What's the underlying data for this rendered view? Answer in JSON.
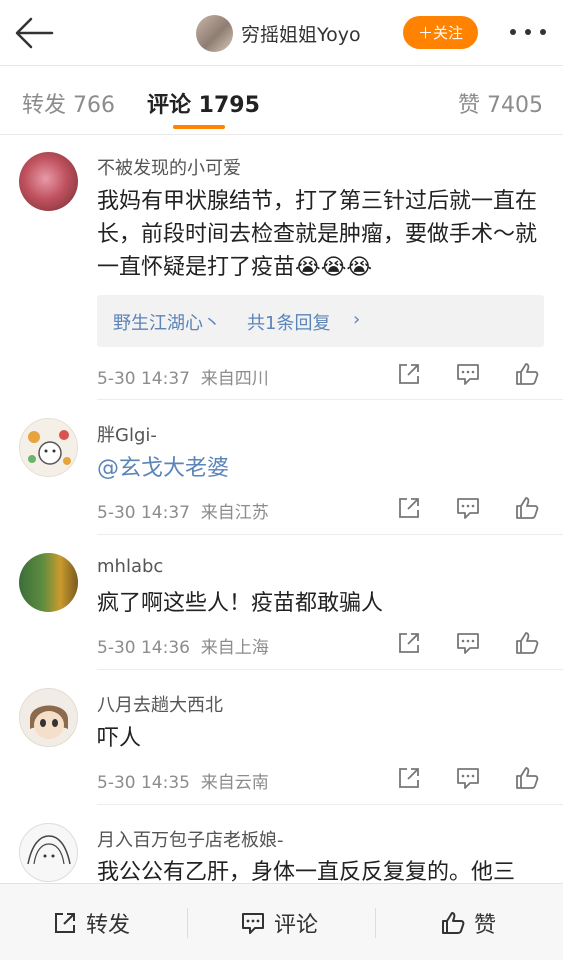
{
  "header": {
    "username": "穷摇姐姐Yoyo",
    "follow_label": "＋关注"
  },
  "tabs": {
    "repost": "转发 766",
    "comment": "评论 1795",
    "like": "赞 7405"
  },
  "comments": [
    {
      "name": "不被发现的小可爱",
      "text": "我妈有甲状腺结节，打了第三针过后就一直在长，前段时间去检查就是肿瘤，要做手术～就一直怀疑是打了疫苗😭😭😭",
      "reply_user": "野生江湖心丶",
      "reply_count": "共1条回复",
      "time": "5-30 14:37",
      "source": "来自四川"
    },
    {
      "name": "胖Glgi-",
      "text": "@玄戈大老婆",
      "time": "5-30 14:37",
      "source": "来自江苏"
    },
    {
      "name": "mhlabc",
      "text": "疯了啊这些人！疫苗都敢骗人",
      "time": "5-30 14:36",
      "source": "来自上海"
    },
    {
      "name": "八月去趟大西北",
      "text": "吓人",
      "time": "5-30 14:35",
      "source": "来自云南"
    },
    {
      "name": "月入百万包子店老板娘-",
      "text": "我公公有乙肝，身体一直反反复复的。他三"
    }
  ],
  "bottom": {
    "repost": "转发",
    "comment": "评论",
    "like": "赞"
  },
  "colors": {
    "accent": "#ff8200",
    "link": "#5b84b8"
  }
}
